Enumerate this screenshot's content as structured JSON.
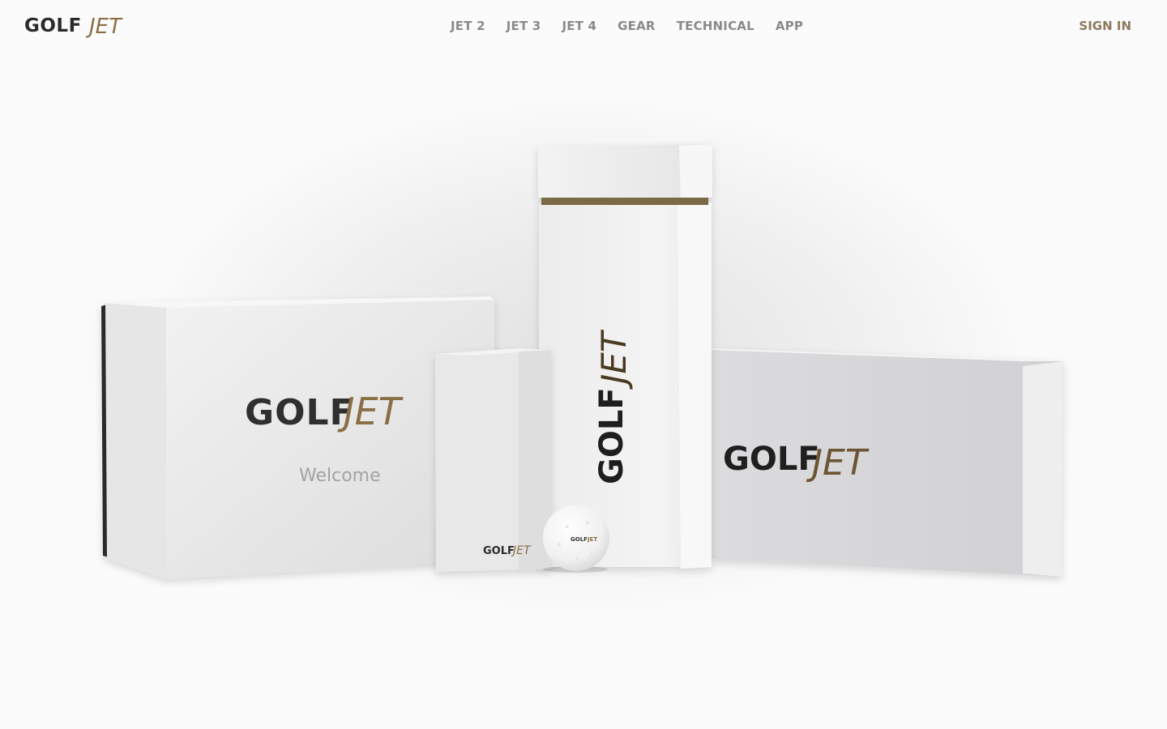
{
  "brand": {
    "name_left": "GOLF",
    "name_right": "JET",
    "colors": {
      "dark": "#2b2b2b",
      "gold": "#8a6f45",
      "nav_text": "#8a8a8a",
      "sign_in": "#8e7a5e"
    }
  },
  "nav": {
    "items": [
      {
        "label": "JET 2"
      },
      {
        "label": "JET 3"
      },
      {
        "label": "JET 4"
      },
      {
        "label": "GEAR"
      },
      {
        "label": "TECHNICAL"
      },
      {
        "label": "APP"
      }
    ],
    "sign_in": "SIGN IN"
  },
  "hero": {
    "welcome_text": "Welcome",
    "logo_left": "GOLF",
    "logo_right": "JET"
  }
}
